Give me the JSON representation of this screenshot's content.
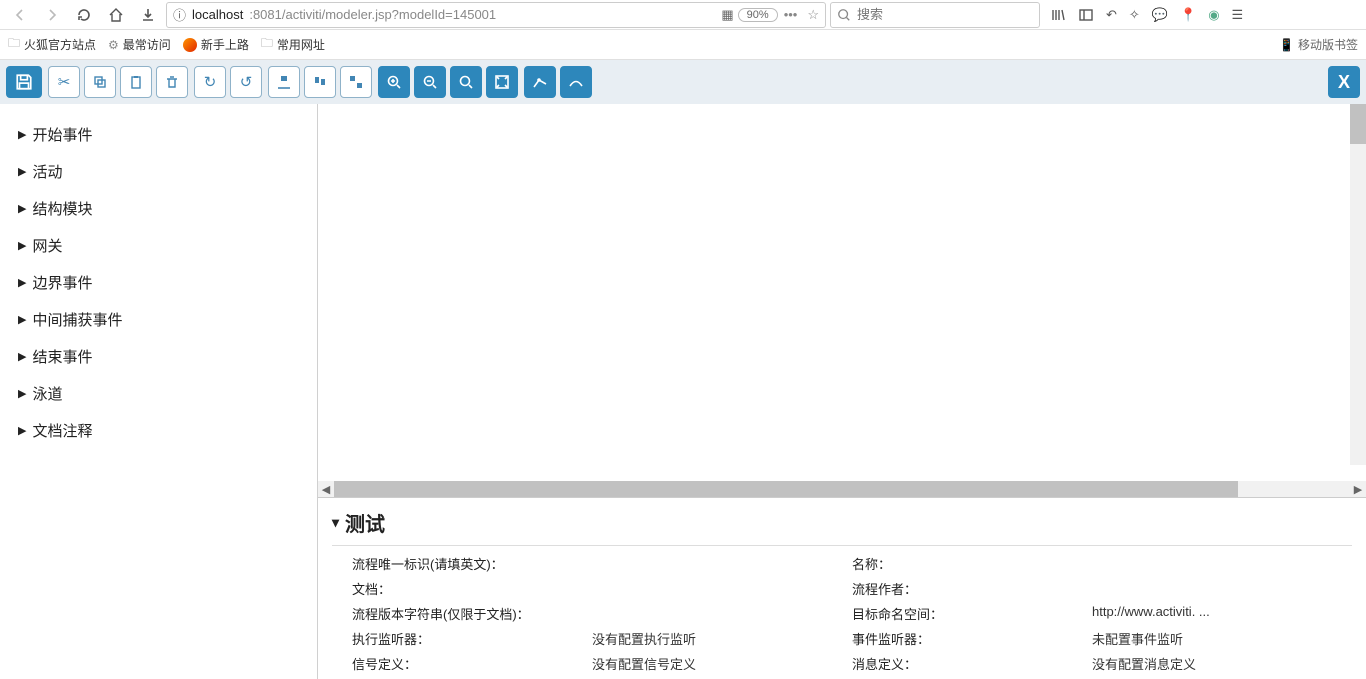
{
  "browser": {
    "url_host": "localhost",
    "url_path": ":8081/activiti/modeler.jsp?modelId=145001",
    "zoom": "90%",
    "search_placeholder": "搜索",
    "bookmarks": [
      {
        "label": "火狐官方站点",
        "icon": "folder"
      },
      {
        "label": "最常访问",
        "icon": "gear"
      },
      {
        "label": "新手上路",
        "icon": "fox"
      },
      {
        "label": "常用网址",
        "icon": "folder"
      }
    ],
    "mobile_label": "移动版书签"
  },
  "toolbar": {
    "save": "save-icon",
    "groups": [
      [
        "cut-icon",
        "copy-icon",
        "paste-icon",
        "delete-icon"
      ],
      [
        "redo-icon",
        "undo-icon"
      ],
      [
        "align-v-icon",
        "align-h-icon",
        "same-size-icon"
      ],
      [
        "zoom-in-icon",
        "zoom-out-icon",
        "zoom-actual-icon",
        "zoom-fit-icon"
      ],
      [
        "bendpoint-add-icon",
        "bendpoint-remove-icon"
      ]
    ],
    "close_label": "X"
  },
  "sidebar": {
    "items": [
      "开始事件",
      "活动",
      "结构模块",
      "网关",
      "边界事件",
      "中间捕获事件",
      "结束事件",
      "泳道",
      "文档注释"
    ]
  },
  "properties": {
    "title": "测试",
    "rows": [
      {
        "l1": "流程唯一标识(请填英文)：",
        "v1": "",
        "l2": "名称：",
        "v2": ""
      },
      {
        "l1": "文档：",
        "v1": "",
        "l2": "流程作者：",
        "v2": ""
      },
      {
        "l1": "流程版本字符串(仅限于文档)：",
        "v1": "",
        "l2": "目标命名空间：",
        "v2": "http://www.activiti. ..."
      },
      {
        "l1": "执行监听器：",
        "v1": "没有配置执行监听",
        "l2": "事件监听器：",
        "v2": "未配置事件监听"
      },
      {
        "l1": "信号定义：",
        "v1": "没有配置信号定义",
        "l2": "消息定义：",
        "v2": "没有配置消息定义"
      }
    ]
  }
}
